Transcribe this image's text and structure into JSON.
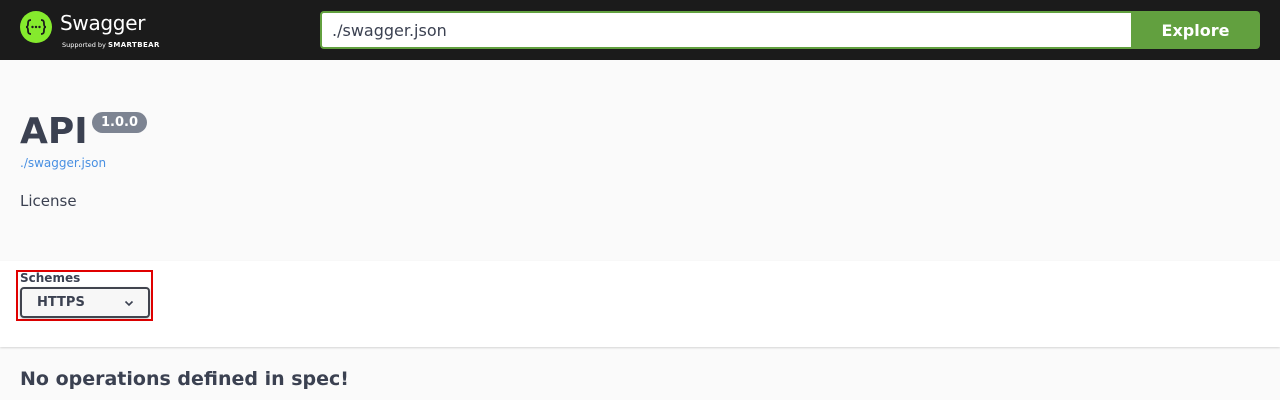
{
  "header": {
    "brand": "Swagger",
    "sub_prefix": "Supported by",
    "sub_brand": "SMARTBEAR",
    "logo_icon": "swagger-braces-icon",
    "url_value": "./swagger.json",
    "explore_label": "Explore",
    "accent_color": "#85ea2d",
    "button_color": "#62a03f"
  },
  "info": {
    "title": "API",
    "version": "1.0.0",
    "spec_url": "./swagger.json",
    "license": "License"
  },
  "schemes": {
    "label": "Schemes",
    "selected": "HTTPS",
    "dropdown_icon": "chevron-down-icon",
    "highlight_color": "#e00000"
  },
  "operations": {
    "empty_message": "No operations defined in spec!"
  }
}
